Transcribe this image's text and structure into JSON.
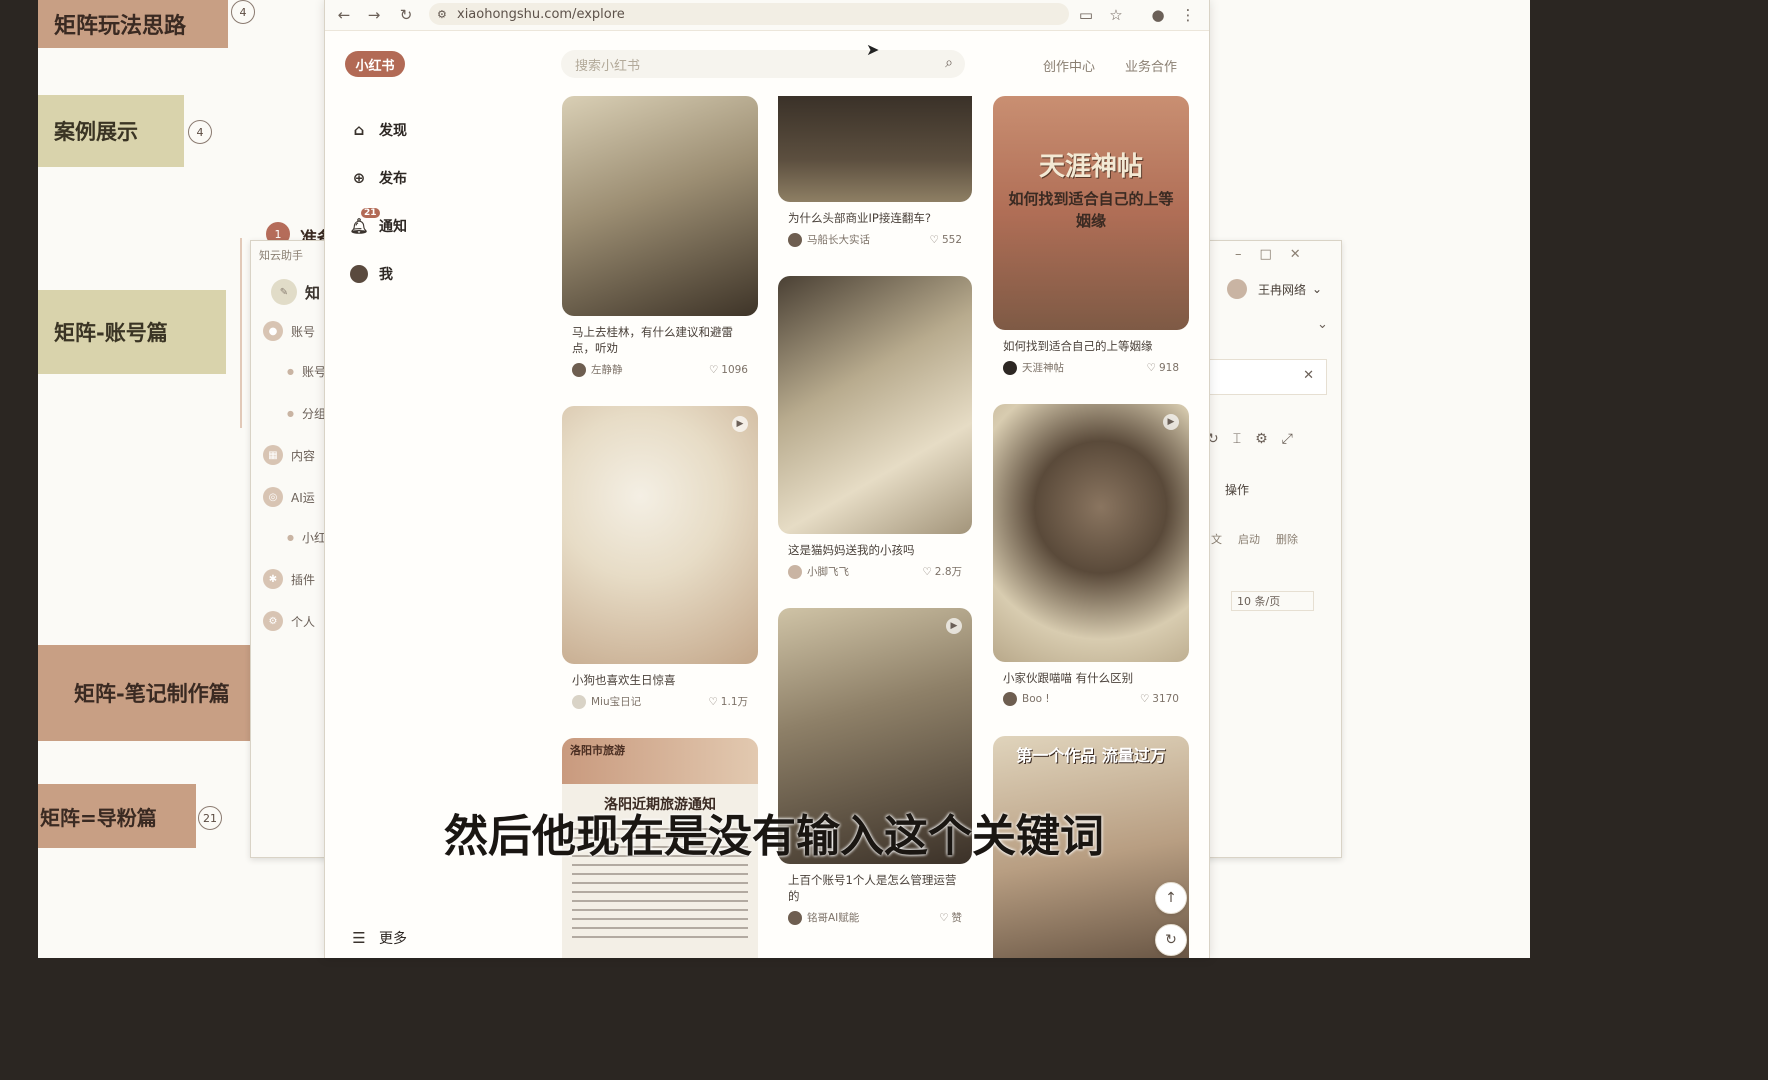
{
  "mindmap": {
    "nodes": [
      {
        "label": "矩阵玩法思路",
        "badge": "4"
      },
      {
        "label": "案例展示",
        "badge": "4"
      },
      {
        "label": "矩阵-账号篇",
        "badge": ""
      },
      {
        "label": "矩阵-笔记制作篇",
        "badge": ""
      },
      {
        "label": "矩阵=导粉篇",
        "badge": "21"
      }
    ],
    "partial_node": "准备",
    "partial_badge": "1"
  },
  "bg_window": {
    "title": "知云助手",
    "header_item": "知",
    "side": [
      "账号",
      "账号",
      "分组",
      "内容",
      "AI运",
      "小红",
      "插件",
      "个人"
    ],
    "user": "王冉网络",
    "actions": "操作",
    "row_actions": [
      "文",
      "启动",
      "删除"
    ],
    "pager": "10 条/页"
  },
  "browser": {
    "url": "xiaohongshu.com/explore",
    "logo": "小红书",
    "search_placeholder": "搜索小红书",
    "links": [
      "创作中心",
      "业务合作"
    ],
    "nav": [
      {
        "label": "发现",
        "icon": "home-icon"
      },
      {
        "label": "发布",
        "icon": "plus-icon"
      },
      {
        "label": "通知",
        "icon": "bell-icon",
        "badge": "21"
      },
      {
        "label": "我",
        "icon": "avatar-icon"
      }
    ],
    "more": "更多"
  },
  "feed": [
    {
      "caption": "马上去桂林，有什么建议和避雷点，听劝",
      "author": "左静静",
      "likes": "1096"
    },
    {
      "caption": "小狗也喜欢生日惊喜",
      "author": "Miu宝日记",
      "likes": "1.1万"
    },
    {
      "caption": "",
      "author": "",
      "likes": "",
      "overlay": "洛阳市旅游",
      "overlay2": "洛阳近期旅游通知"
    },
    {
      "caption": "为什么头部商业IP接连翻车?",
      "author": "马船长大实话",
      "likes": "552"
    },
    {
      "caption": "这是猫妈妈送我的小孩吗",
      "author": "小脚飞飞",
      "likes": "2.8万"
    },
    {
      "caption": "上百个账号1个人是怎么管理运营的",
      "author": "铭哥AI赋能",
      "likes": "赞"
    },
    {
      "caption": "如何找到适合自己的上等姻缘",
      "author": "天涯神帖",
      "likes": "918",
      "overlay": "天涯神帖",
      "overlay2": "如何找到适合自己的上等姻缘"
    },
    {
      "caption": "小家伙跟喵喵 有什么区别",
      "author": "Boo !",
      "likes": "3170"
    },
    {
      "caption": "",
      "author": "",
      "likes": "",
      "overlay": "第一个作品 流量过万"
    }
  ],
  "subtitle": "然后他现在是没有输入这个关键词"
}
